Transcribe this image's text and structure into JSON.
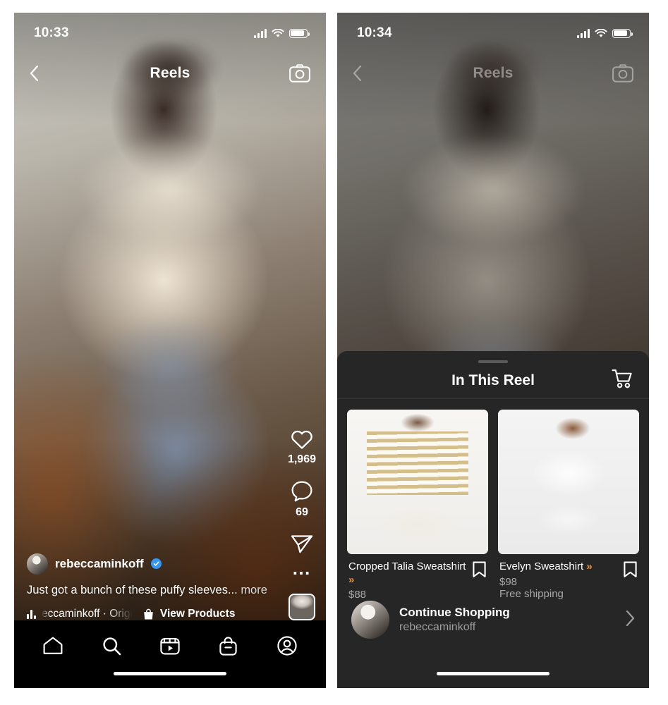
{
  "phones": [
    {
      "id": "reel-view",
      "status": {
        "clock": "10:33",
        "signal_icon": "cellular-signal-icon",
        "wifi_icon": "wifi-icon",
        "battery_icon": "battery-icon"
      },
      "nav": {
        "back_icon": "back-chevron-icon",
        "title": "Reels",
        "camera_icon": "camera-icon"
      },
      "rail": {
        "like_icon": "heart-icon",
        "like_count": "1,969",
        "comment_icon": "comment-bubble-icon",
        "comment_count": "69",
        "share_icon": "share-paper-plane-icon",
        "more_icon": "more-dots-icon",
        "thumbnail": "audio-thumbnail"
      },
      "caption": {
        "avatar": "user-avatar",
        "username": "rebeccaminkoff",
        "verified_icon": "verified-badge-icon",
        "text": "Just got a bunch of these puffy sleeves...",
        "more_label": "more",
        "audio_icon": "audio-equalizer-icon",
        "audio_text": "eccaminkoff · Origi",
        "products_icon": "shopping-bag-icon",
        "products_label": "View Products"
      },
      "tabs": [
        {
          "name": "home",
          "icon": "home-icon"
        },
        {
          "name": "search",
          "icon": "search-icon"
        },
        {
          "name": "reels",
          "icon": "reels-icon"
        },
        {
          "name": "shop",
          "icon": "shopping-bag-icon"
        },
        {
          "name": "profile",
          "icon": "profile-avatar-icon"
        }
      ]
    },
    {
      "id": "shopping-sheet-view",
      "status": {
        "clock": "10:34",
        "signal_icon": "cellular-signal-icon",
        "wifi_icon": "wifi-icon",
        "battery_icon": "battery-icon"
      },
      "nav": {
        "back_icon": "back-chevron-icon",
        "title": "Reels",
        "camera_icon": "camera-icon"
      },
      "sheet": {
        "grabber": "drag-handle",
        "title": "In This Reel",
        "cart_icon": "shopping-cart-icon",
        "products": [
          {
            "name": "Cropped Talia Sweatshirt",
            "chevron": "»",
            "price": "$88",
            "shipping": "",
            "bookmark_icon": "bookmark-icon",
            "image": "striped-sweatshirt-photo"
          },
          {
            "name": "Evelyn Sweatshirt",
            "chevron": "»",
            "price": "$98",
            "shipping": "Free shipping",
            "bookmark_icon": "bookmark-icon",
            "image": "white-ruffle-sweatshirt-photo"
          }
        ],
        "continue": {
          "avatar": "merchant-avatar",
          "title": "Continue Shopping",
          "subtitle": "rebeccaminkoff",
          "arrow_icon": "chevron-right-icon"
        }
      }
    }
  ],
  "colors": {
    "sheet_bg": "#262626",
    "tabbar_bg": "#000000",
    "accent_orange": "#e8913c",
    "verified_blue": "#3897f0",
    "muted_text": "#a8a8a8"
  }
}
